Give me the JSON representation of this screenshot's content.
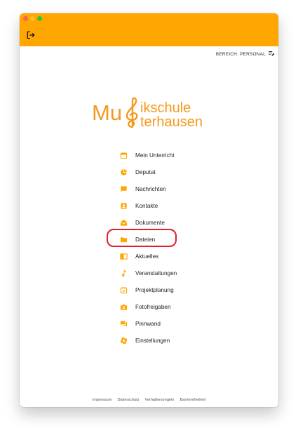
{
  "window": {
    "colors": {
      "accent": "#FFA600",
      "highlight": "#E0202A",
      "close": "#FE5F57",
      "minimize": "#FEBC2E",
      "zoom": "#28C840"
    }
  },
  "appbar": {
    "logout_icon": "logout-icon"
  },
  "bereich": {
    "label": "BEREICH: PERSONAL",
    "icon": "edit-list-icon"
  },
  "logo": {
    "line1_left": "Mu",
    "line1_right": "ikschule",
    "line2": "terhausen",
    "emblem": "treble-clef-icon"
  },
  "menu": {
    "items": [
      {
        "label": "Mein Unterricht",
        "icon": "calendar-icon"
      },
      {
        "label": "Deputat",
        "icon": "pie-chart-icon"
      },
      {
        "label": "Nachrichten",
        "icon": "message-icon"
      },
      {
        "label": "Kontakte",
        "icon": "contact-icon"
      },
      {
        "label": "Dokumente",
        "icon": "mail-open-icon"
      },
      {
        "label": "Dateien",
        "icon": "folder-icon",
        "highlighted": true
      },
      {
        "label": "Aktuelles",
        "icon": "news-icon"
      },
      {
        "label": "Veranstaltungen",
        "icon": "music-note-icon"
      },
      {
        "label": "Projektplanung",
        "icon": "event-check-icon"
      },
      {
        "label": "Fotofreigaben",
        "icon": "camera-icon"
      },
      {
        "label": "Pinnwand",
        "icon": "forum-icon"
      },
      {
        "label": "Einstellungen",
        "icon": "gear-icon"
      }
    ]
  },
  "footer": {
    "links": [
      "Impressum",
      "Datenschutz",
      "Verhaltensregeln",
      "Barrierefreiheit"
    ]
  }
}
